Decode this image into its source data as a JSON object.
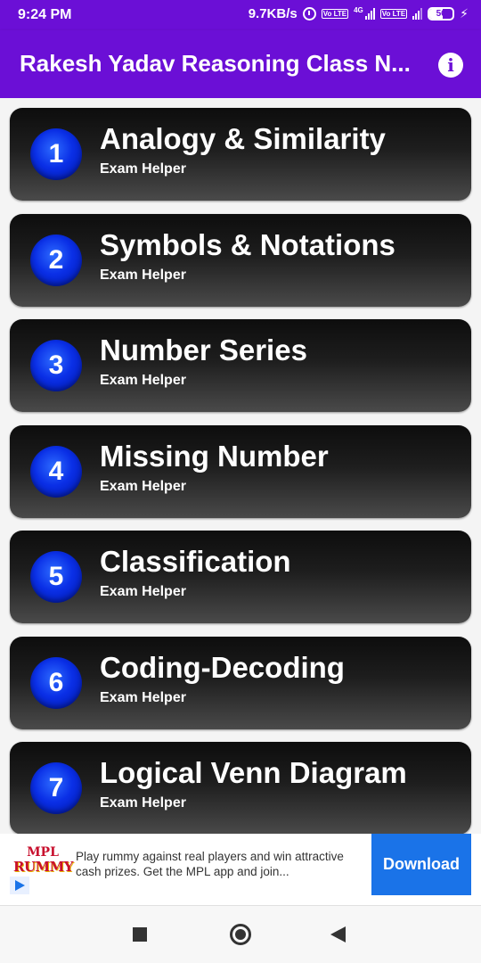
{
  "status_bar": {
    "time": "9:24 PM",
    "network_speed": "9.7KB/s",
    "volte_label": "Vo LTE",
    "network_type": "4G",
    "battery_level": "56",
    "battery_percent": 56,
    "icons": [
      "alarm-icon",
      "volte-icon",
      "signal-icon",
      "battery-icon",
      "charging-icon"
    ]
  },
  "app_bar": {
    "title": "Rakesh Yadav Reasoning Class N...",
    "info_icon_glyph": "i",
    "background_color": "#6b0fd6"
  },
  "list": {
    "items": [
      {
        "number": "1",
        "title": "Analogy & Similarity",
        "subtitle": "Exam Helper"
      },
      {
        "number": "2",
        "title": "Symbols & Notations",
        "subtitle": "Exam Helper"
      },
      {
        "number": "3",
        "title": "Number Series",
        "subtitle": "Exam Helper"
      },
      {
        "number": "4",
        "title": "Missing Number",
        "subtitle": "Exam Helper"
      },
      {
        "number": "5",
        "title": "Classification",
        "subtitle": "Exam Helper"
      },
      {
        "number": "6",
        "title": "Coding-Decoding",
        "subtitle": "Exam Helper"
      },
      {
        "number": "7",
        "title": "Logical Venn Diagram",
        "subtitle": "Exam Helper"
      }
    ]
  },
  "ad": {
    "logo_top": "MPL",
    "logo_bottom": "RUMMY",
    "text": "Play rummy against real players and win attractive cash prizes. Get the MPL app and join...",
    "button_label": "Download",
    "button_color": "#1a73e8"
  },
  "nav_bar": {
    "icons": [
      "recents-icon",
      "home-icon",
      "back-icon"
    ]
  }
}
